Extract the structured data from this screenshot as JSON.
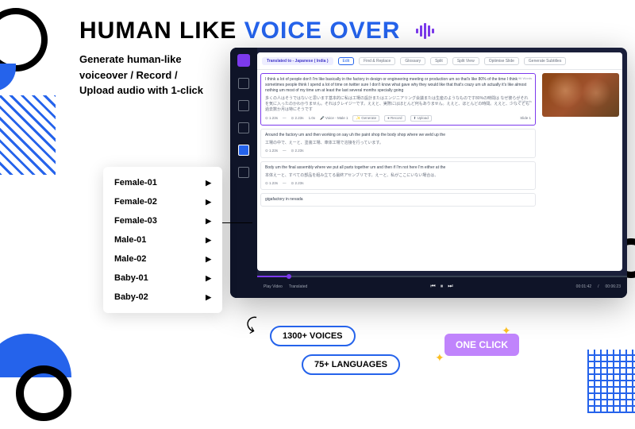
{
  "headline": {
    "part1": "HUMAN LIKE ",
    "part2": "VOICE OVER"
  },
  "subhead": "Generate human-like\nvoiceover / Record /\nUpload audio with 1-click",
  "voices": [
    {
      "name": "Female-01"
    },
    {
      "name": "Female-02"
    },
    {
      "name": "Female-03"
    },
    {
      "name": "Male-01"
    },
    {
      "name": "Male-02"
    },
    {
      "name": "Baby-01"
    },
    {
      "name": "Baby-02"
    }
  ],
  "topbar": {
    "translated_to": "Translated to - Japanese ( India )",
    "edit": "Edit",
    "find_replace": "Find & Replace",
    "glossary": "Glossary",
    "split": "Split",
    "split_view": "Split View",
    "optimize": "Optimise Slide",
    "subtitles": "Generate Subtitles"
  },
  "segments": [
    {
      "en": "I think a lot of people don't I'm like basically in the factory in design or engineering meeting or production um so that's like 80% of the time I think sometimes people think I spend a lot of time on twitter sure I don't know what gave why they would like that that's crazy um uh actually it's like almost nothing um most of my time um at least the last several months specially going",
      "jp": "多くの人はそうではないと思います基本的に私は工場の設計またはエンジニアリング会議または生産のようなものです80%の時間は なぜ彼らがそれを気に入ったのかわかりません。それはクレイジーです。ええと、実際にはほとんど何もありません。ええと、ほとんどの時間。ええと、少なくとも過去数か月は特にそうです",
      "t1": "1.23s",
      "t2": "2.23s",
      "speed": "1.0x",
      "voice": "Voice - Male 1",
      "gen": "Generate",
      "rec": "Record",
      "up": "Upload",
      "wc1": "96 Words",
      "wc2": "96 Words",
      "slide": "Slide 1"
    },
    {
      "en": "Around the factory um and then working on say uh the paint shop the body shop where we weld up the",
      "jp": "工場の中で、えーと、塗装工場、車体工場で溶接を行っています。",
      "t1": "1.23s",
      "t2": "2.23s"
    },
    {
      "en": "Body um the final assembly where we put all parts together um and then if I'm not here I'm either at the",
      "jp": "本体えーと、すべての部品を組み立てる最終アセンブリです。えーと、私がここにいない場合は、",
      "t1": "1.23s",
      "t2": "2.23s"
    },
    {
      "en": "gigafactory in nevada",
      "jp": "",
      "t1": "",
      "t2": ""
    }
  ],
  "player": {
    "play_video": "Play Video",
    "translated": "Translated",
    "current": "00:01:42",
    "total": "00:06:23"
  },
  "badges": {
    "voices": "1300+ VOICES",
    "langs": "75+ LANGUAGES",
    "oneclick": "ONE CLICK"
  }
}
